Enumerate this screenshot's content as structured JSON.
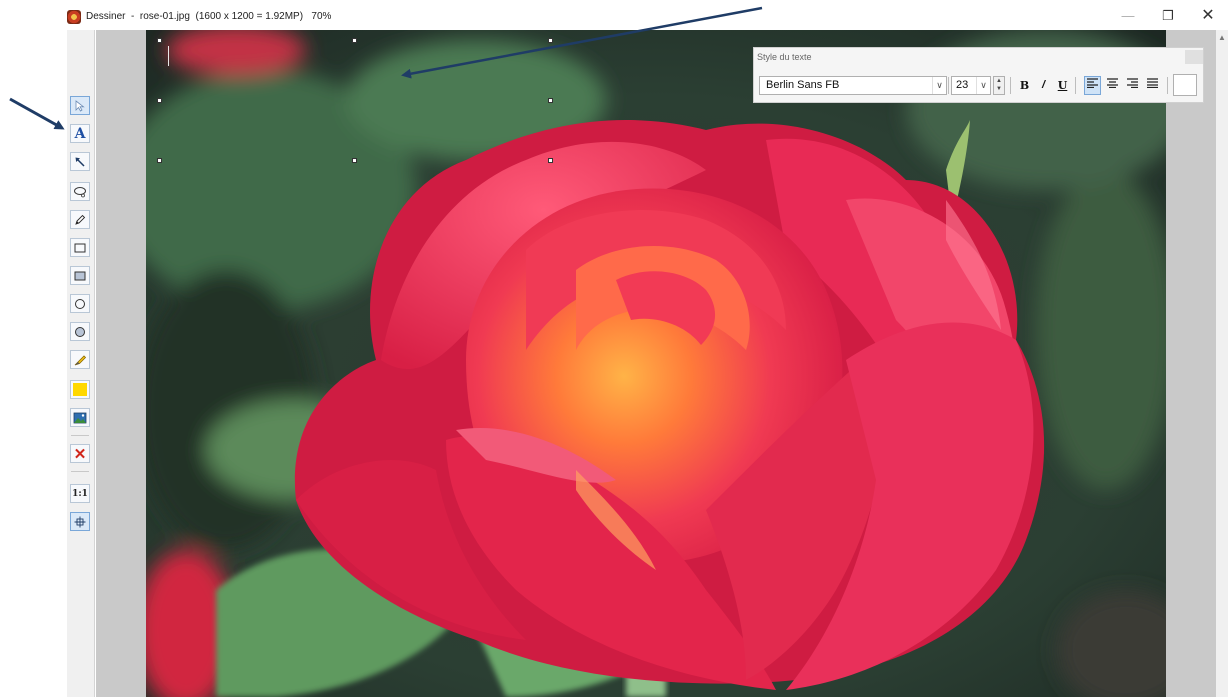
{
  "window": {
    "title": "Dessiner  -  rose-01.jpg  (1600 x 1200 = 1.92MP)   70%",
    "minimize_glyph": "—",
    "restore_glyph": "❐",
    "close_glyph": "✕"
  },
  "tools": [
    {
      "name": "select-arrow-tool",
      "glyph": "▷",
      "active": true
    },
    {
      "name": "text-tool",
      "glyph": "A"
    },
    {
      "name": "arrow-tool",
      "glyph": "↖"
    },
    {
      "name": "lasso-tool",
      "glyph": "◯"
    },
    {
      "name": "pencil-tool",
      "glyph": "✎"
    },
    {
      "name": "rectangle-outline-tool",
      "glyph": "□"
    },
    {
      "name": "rectangle-filled-tool",
      "glyph": "■"
    },
    {
      "name": "ellipse-outline-tool",
      "glyph": "○"
    },
    {
      "name": "ellipse-filled-tool",
      "glyph": "●"
    },
    {
      "name": "highlighter-tool",
      "glyph": "✐"
    },
    {
      "name": "fill-color-tool",
      "glyph": "■"
    },
    {
      "name": "image-tool",
      "glyph": "▣"
    },
    {
      "name": "delete-tool",
      "glyph": "✕"
    },
    {
      "name": "actual-size-tool",
      "glyph": "1:1"
    },
    {
      "name": "fit-tool",
      "glyph": "✥"
    }
  ],
  "style_panel": {
    "title": "Style du texte",
    "font_name": "Berlin Sans FB",
    "font_size": "23",
    "bold_label": "B",
    "italic_label": "/",
    "underline_label": "U",
    "align_left_glyph": "≡",
    "align_center_glyph": "≡",
    "align_right_glyph": "≡",
    "justify_glyph": "≡",
    "dropdown_glyph": "∨"
  },
  "colors": {
    "toolbar_accent": "#2c4a75",
    "annotation_arrow": "#1f3c66",
    "rose": "#e63350",
    "selection_handle": "#ffffff"
  }
}
